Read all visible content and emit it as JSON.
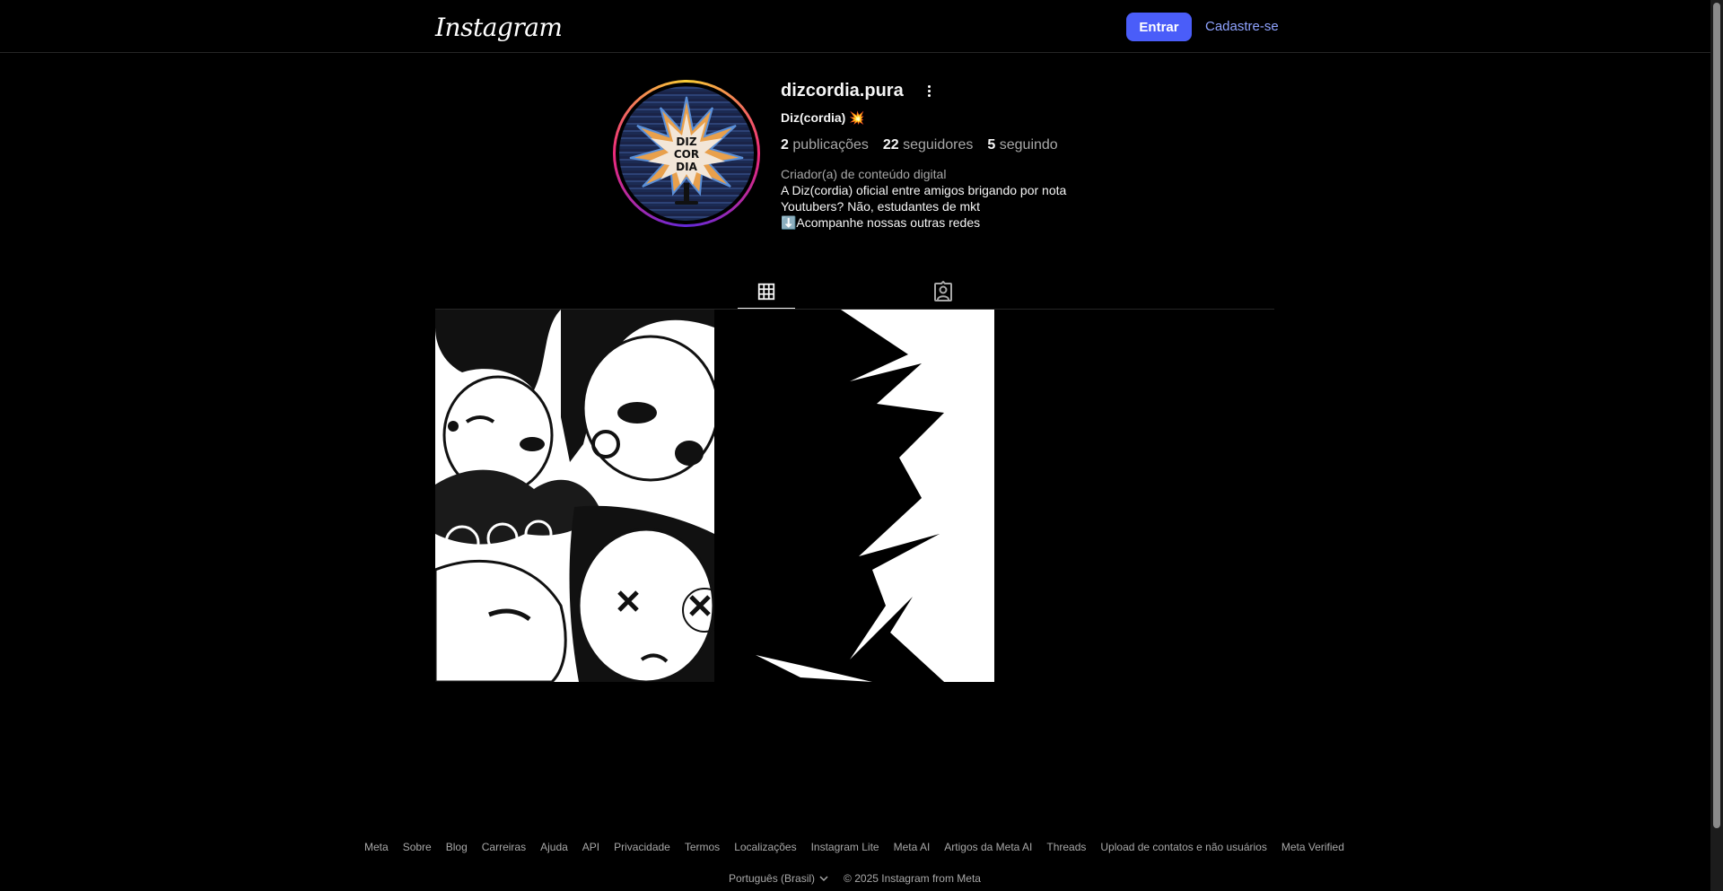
{
  "header": {
    "logo_text": "Instagram",
    "login_label": "Entrar",
    "signup_label": "Cadastre-se"
  },
  "profile": {
    "username": "dizcordia.pura",
    "full_name": "Diz(cordia) 💥",
    "avatar_text": "DIZ COR DIA",
    "stats": [
      {
        "count": "2",
        "label": "publicações"
      },
      {
        "count": "22",
        "label": "seguidores"
      },
      {
        "count": "5",
        "label": "seguindo"
      }
    ],
    "category": "Criador(a) de conteúdo digital",
    "bio_lines": [
      "A Diz(cordia) oficial entre amigos brigando por nota",
      "Youtubers? Não, estudantes de mkt",
      "⬇️Acompanhe nossas outras redes"
    ]
  },
  "tabs": [
    {
      "icon": "grid-icon",
      "active": true
    },
    {
      "icon": "tagged-icon",
      "active": false
    }
  ],
  "posts_count": 2,
  "footer": {
    "links": [
      "Meta",
      "Sobre",
      "Blog",
      "Carreiras",
      "Ajuda",
      "API",
      "Privacidade",
      "Termos",
      "Localizações",
      "Instagram Lite",
      "Meta AI",
      "Artigos da Meta AI",
      "Threads",
      "Upload de contatos e não usuários",
      "Meta Verified"
    ],
    "language": "Português (Brasil)",
    "copyright": "© 2025 Instagram from Meta"
  },
  "colors": {
    "background": "#000000",
    "primary_button": "#4a5df9",
    "link": "#8fa3ff",
    "secondary_text": "#a8a8a8"
  }
}
